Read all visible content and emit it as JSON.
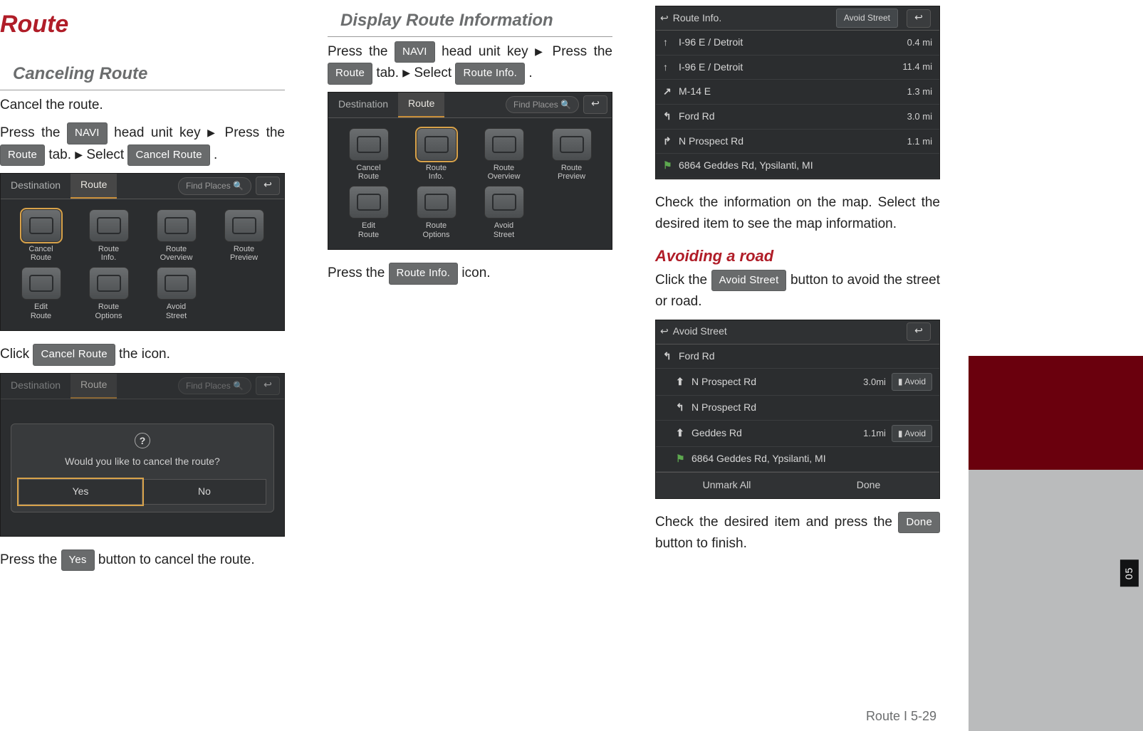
{
  "page": {
    "title": "Route",
    "footer": "Route I 5-29",
    "chapter_tab": "05"
  },
  "buttons": {
    "navi": "NAVI",
    "route": "Route",
    "cancel_route": "Cancel Route",
    "route_info": "Route Info.",
    "yes": "Yes",
    "avoid_street": "Avoid Street",
    "done": "Done"
  },
  "glyphs": {
    "tri": "▶"
  },
  "col1": {
    "heading": "Canceling Route",
    "p1": "Cancel the route.",
    "p2a": "Press  the ",
    "p2b": " head unit key ",
    "p2c": " Press the  ",
    "p2d": " tab. ",
    "p2e": " Select ",
    "p2f": " .",
    "p3a": "Click ",
    "p3b": " the icon.",
    "p4a": "Press the ",
    "p4b": " button to cancel the route."
  },
  "col2": {
    "heading": "Display Route Information",
    "p1a": "Press  the ",
    "p1b": " head unit key ",
    "p1c": " Press the  ",
    "p1d": " tab. ",
    "p1e": " Select ",
    "p1f": " .",
    "p2a": "Press the ",
    "p2b": " icon."
  },
  "col3": {
    "p1": "Check the information on the map. Select the desired item to see the map infor­ma­tion.",
    "sub": "Avoiding a road",
    "p2a": "Click the ",
    "p2b": " button to avoid the street or road.",
    "p3a": "Check the desired item and press the ",
    "p3b": " button to finish."
  },
  "shot_tabs": {
    "destination": "Destination",
    "route": "Route",
    "find_places": "Find Places",
    "back": "↩"
  },
  "route_icons": {
    "cancel": "Cancel\nRoute",
    "info": "Route\nInfo.",
    "overview": "Route\nOverview",
    "preview": "Route\nPreview",
    "edit": "Edit\nRoute",
    "options": "Route\nOptions",
    "avoid": "Avoid\nStreet"
  },
  "dialog": {
    "text": "Would you like to cancel the route?",
    "yes": "Yes",
    "no": "No"
  },
  "route_info_list": {
    "title": "Route Info.",
    "chip": "Avoid Street",
    "rows": [
      {
        "arrow": "↑",
        "name": "I-96 E / Detroit",
        "dist": "0.4 mi"
      },
      {
        "arrow": "↑",
        "name": "I-96 E / Detroit",
        "dist": "11.4 mi"
      },
      {
        "arrow": "↗",
        "name": "M-14 E",
        "dist": "1.3 mi"
      },
      {
        "arrow": "↰",
        "name": "Ford Rd",
        "dist": "3.0 mi"
      },
      {
        "arrow": "↱",
        "name": "N Prospect Rd",
        "dist": "1.1 mi"
      },
      {
        "arrow": "⚑",
        "name": "6864 Geddes Rd, Ypsilanti, MI",
        "dist": ""
      }
    ]
  },
  "avoid_list": {
    "title": "Avoid Street",
    "rows": [
      {
        "arrow": "↰",
        "name": "Ford Rd",
        "dist": "",
        "chip": ""
      },
      {
        "arrow": "⬆",
        "name": "N Prospect Rd",
        "dist": "3.0mi",
        "chip": "Avoid"
      },
      {
        "arrow": "↰",
        "name": "N Prospect Rd",
        "dist": "",
        "chip": ""
      },
      {
        "arrow": "⬆",
        "name": "Geddes Rd",
        "dist": "1.1mi",
        "chip": "Avoid"
      },
      {
        "arrow": "⚑",
        "name": "6864 Geddes Rd, Ypsilanti, MI",
        "dist": "",
        "chip": ""
      }
    ],
    "unmark": "Unmark All",
    "done": "Done"
  }
}
